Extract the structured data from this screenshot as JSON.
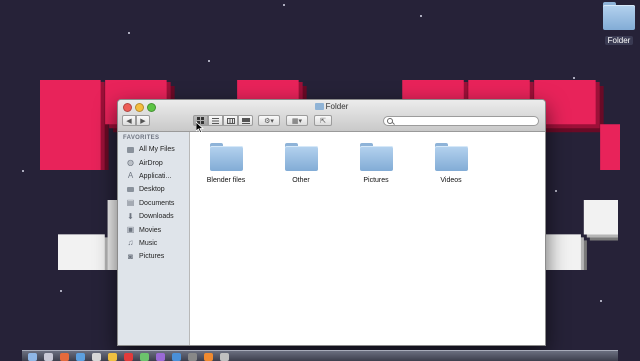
{
  "window": {
    "title": "Folder",
    "nav": {
      "back_icon": "◀",
      "forward_icon": "▶"
    },
    "view_buttons": [
      "icon-view",
      "list-view",
      "column-view",
      "coverflow-view"
    ],
    "action_icon": "gear-icon",
    "arrange_icon": "grid-icon",
    "share_icon": "share-icon",
    "search_placeholder": ""
  },
  "sidebar": {
    "heading": "FAVORITES",
    "items": [
      {
        "label": "All My Files",
        "icon": "files-icon"
      },
      {
        "label": "AirDrop",
        "icon": "airdrop-icon"
      },
      {
        "label": "Applicati...",
        "icon": "applications-icon"
      },
      {
        "label": "Desktop",
        "icon": "desktop-icon"
      },
      {
        "label": "Documents",
        "icon": "documents-icon"
      },
      {
        "label": "Downloads",
        "icon": "downloads-icon"
      },
      {
        "label": "Movies",
        "icon": "movies-icon"
      },
      {
        "label": "Music",
        "icon": "music-icon"
      },
      {
        "label": "Pictures",
        "icon": "pictures-icon"
      }
    ]
  },
  "files": [
    {
      "name": "Blender files"
    },
    {
      "name": "Other"
    },
    {
      "name": "Pictures"
    },
    {
      "name": "Videos"
    }
  ],
  "desktop": {
    "folder_label": "Folder"
  },
  "colors": {
    "wallpaper": "#262238",
    "title_red": "#e8235a",
    "folder_blue": "#82acd6"
  }
}
